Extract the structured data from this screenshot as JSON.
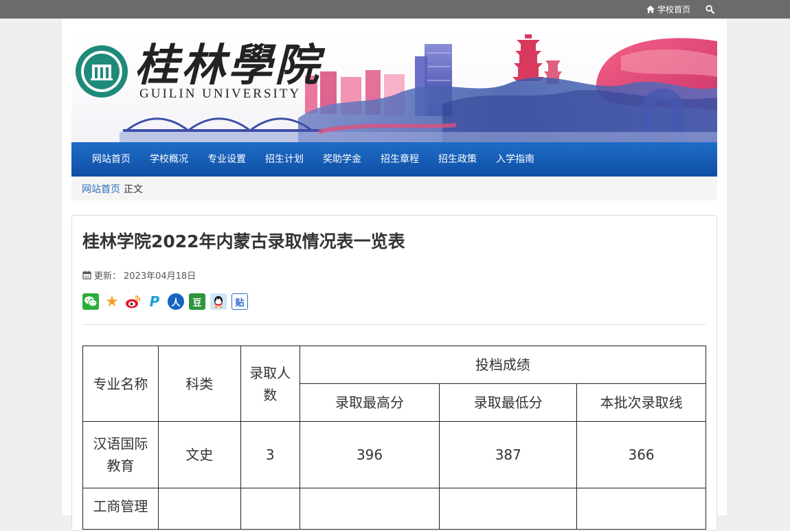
{
  "topbar": {
    "home_label": "学校首页",
    "home_icon": "home-icon",
    "search_icon": "search-icon"
  },
  "banner": {
    "logo_cn": "桂林學院",
    "logo_en": "GUILIN UNIVERSITY"
  },
  "nav": {
    "items": [
      {
        "label": "网站首页"
      },
      {
        "label": "学校概况"
      },
      {
        "label": "专业设置"
      },
      {
        "label": "招生计划"
      },
      {
        "label": "奖助学金"
      },
      {
        "label": "招生章程"
      },
      {
        "label": "招生政策"
      },
      {
        "label": "入学指南"
      }
    ]
  },
  "breadcrumb": {
    "home": "网站首页",
    "current": "正文"
  },
  "article": {
    "title": "桂林学院2022年内蒙古录取情况表一览表",
    "updated_label": "更新：",
    "updated_date": "2023年04月18日"
  },
  "share_icons": [
    {
      "name": "wechat-icon",
      "glyph": "",
      "color": "#2aae3b"
    },
    {
      "name": "favorite-star-icon",
      "glyph": "★",
      "color": "#f0a020"
    },
    {
      "name": "weibo-icon",
      "glyph": "",
      "color": "#e6162d"
    },
    {
      "name": "pengyou-icon",
      "glyph": "P",
      "color": "#1a9fd8"
    },
    {
      "name": "renren-icon",
      "glyph": "人",
      "color": "#1565c0"
    },
    {
      "name": "douban-icon",
      "glyph": "豆",
      "color": "#2e963d"
    },
    {
      "name": "qq-icon",
      "glyph": "",
      "color": "#1a1a1a"
    },
    {
      "name": "tieba-icon",
      "glyph": "贴",
      "color": "#2b6acb"
    }
  ],
  "table": {
    "headers": {
      "major": "专业名称",
      "category": "科类",
      "count": "录取人数",
      "group": "投档成绩",
      "max": "录取最高分",
      "min": "录取最低分",
      "line": "本批次录取线"
    },
    "rows": [
      {
        "major": "汉语国际教育",
        "category": "文史",
        "count": "3",
        "max": "396",
        "min": "387",
        "line": "366"
      },
      {
        "major": "工商管理",
        "category": "",
        "count": "",
        "max": "",
        "min": "",
        "line": ""
      }
    ]
  },
  "colors": {
    "nav_blue": "#1a5fb4",
    "topbar_gray": "#6b6b6b",
    "link_blue": "#2a6ebb"
  }
}
